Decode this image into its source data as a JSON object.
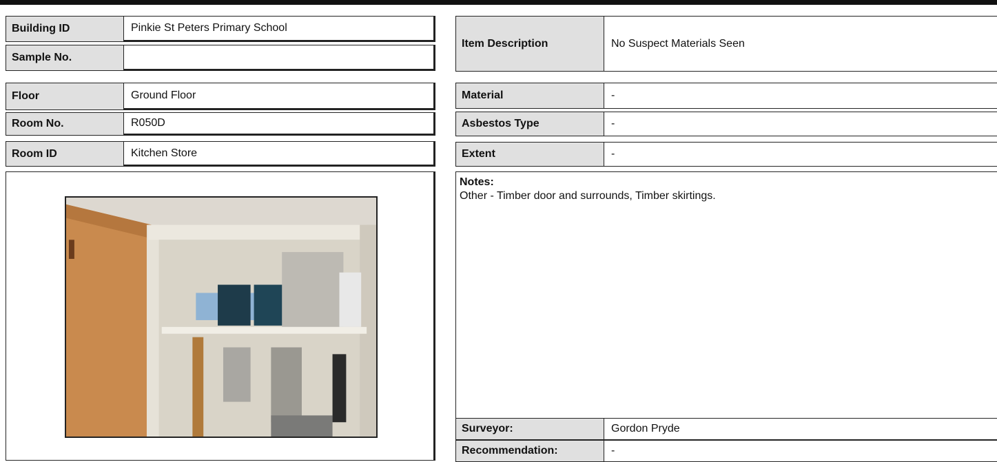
{
  "left": {
    "building_id": {
      "label": "Building ID",
      "value": "Pinkie St Peters Primary School"
    },
    "sample_no": {
      "label": "Sample No.",
      "value": ""
    },
    "floor": {
      "label": "Floor",
      "value": "Ground Floor"
    },
    "room_no": {
      "label": "Room No.",
      "value": "R050D"
    },
    "room_id": {
      "label": "Room ID",
      "value": "Kitchen Store"
    }
  },
  "right": {
    "item_description": {
      "label": "Item Description",
      "value": "No Suspect Materials Seen"
    },
    "material": {
      "label": "Material",
      "value": "-"
    },
    "asbestos_type": {
      "label": "Asbestos Type",
      "value": "-"
    },
    "extent": {
      "label": "Extent",
      "value": "-"
    },
    "notes": {
      "title": "Notes:",
      "text": "Other - Timber door and surrounds, Timber skirtings."
    },
    "surveyor": {
      "label": "Surveyor:",
      "value": "Gordon Pryde"
    },
    "recommendation": {
      "label": "Recommendation:",
      "value": "-"
    }
  },
  "colors": {
    "label_bg": "#e0e0e0",
    "border": "#222222"
  }
}
